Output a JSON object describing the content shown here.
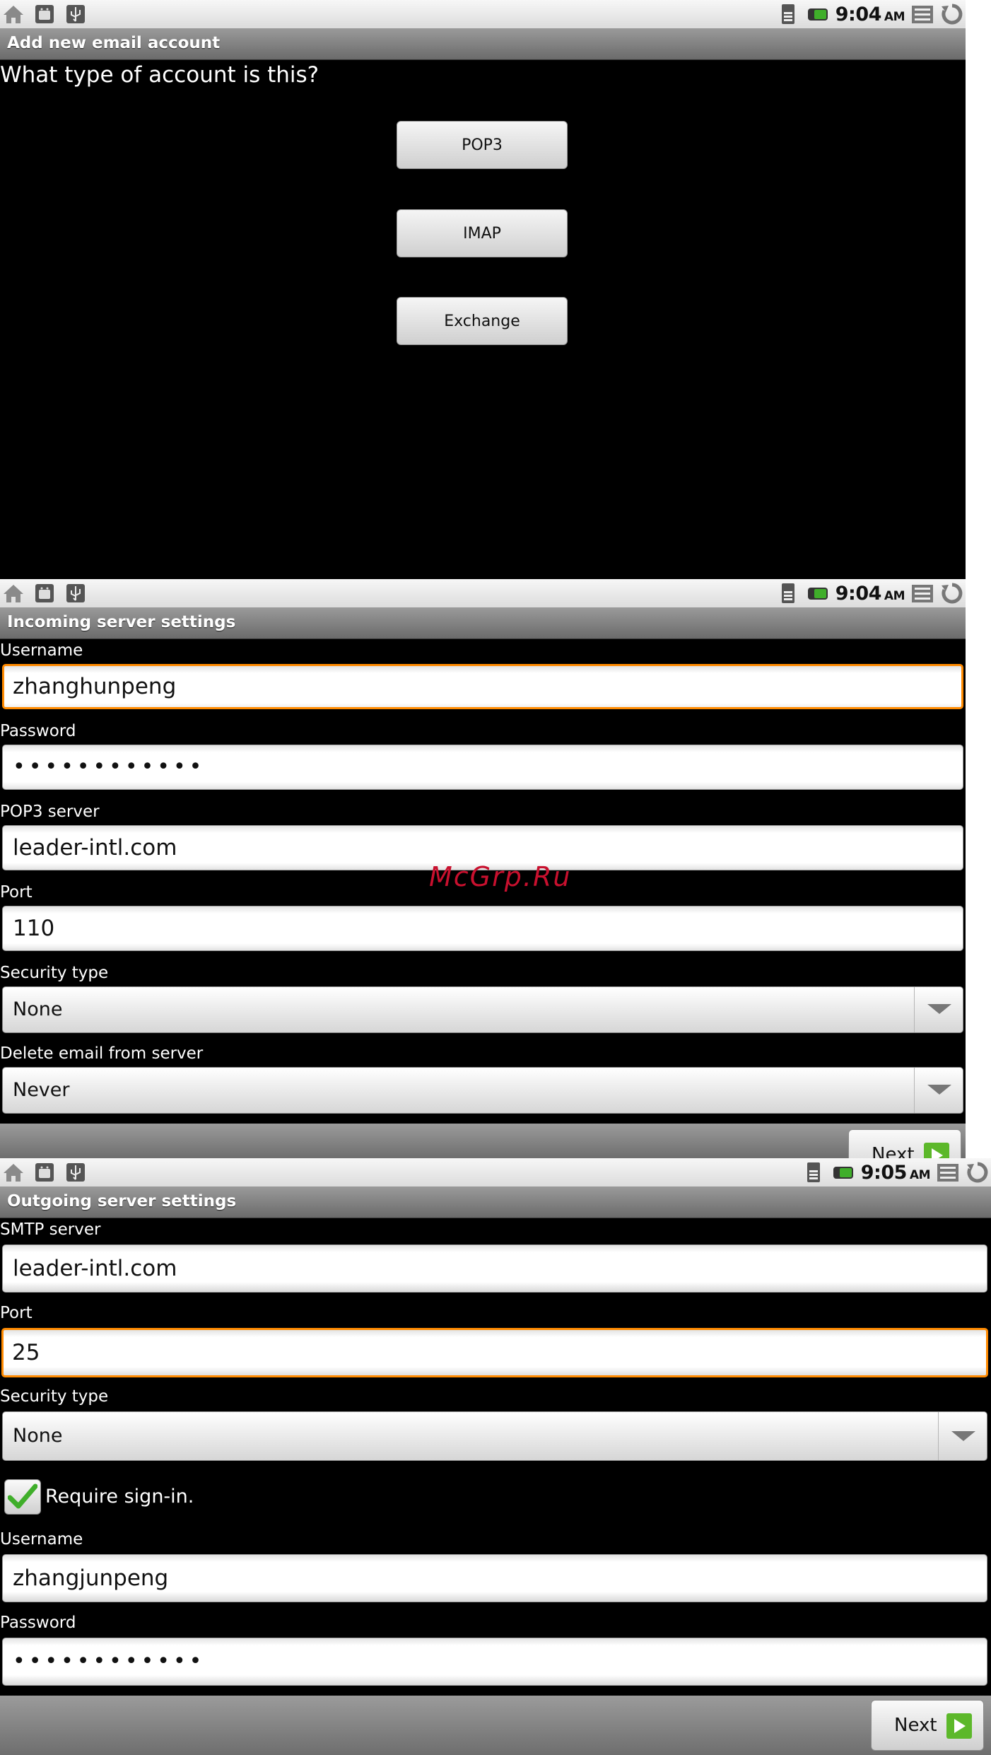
{
  "screen1": {
    "status": {
      "time": "9:04",
      "ampm": "AM"
    },
    "title": "Add new email account",
    "question": "What type of account is this?",
    "buttons": [
      "POP3",
      "IMAP",
      "Exchange"
    ]
  },
  "screen2": {
    "status": {
      "time": "9:04",
      "ampm": "AM"
    },
    "title": "Incoming server settings",
    "username_label": "Username",
    "username_value": "zhanghunpeng",
    "password_label": "Password",
    "password_value": "••••••••••••",
    "server_label": "POP3 server",
    "server_value": "leader-intl.com",
    "port_label": "Port",
    "port_value": "110",
    "security_label": "Security type",
    "security_value": "None",
    "delete_label": "Delete email from server",
    "delete_value": "Never",
    "next_label": "Next"
  },
  "screen3": {
    "status": {
      "time": "9:05",
      "ampm": "AM"
    },
    "title": "Outgoing server settings",
    "server_label": "SMTP server",
    "server_value": "leader-intl.com",
    "port_label": "Port",
    "port_value": "25",
    "security_label": "Security type",
    "security_value": "None",
    "require_signin_label": "Require sign-in.",
    "require_signin_checked": true,
    "username_label": "Username",
    "username_value": "zhangjunpeng",
    "password_label": "Password",
    "password_value": "••••••••••••",
    "next_label": "Next"
  },
  "watermark": "McGrp.Ru",
  "colors": {
    "focus_border": "#ff8a00",
    "title_bar": "#7d7d7d",
    "next_arrow": "#5cb82a",
    "check": "#3fae2a",
    "watermark": "#c8102e"
  },
  "icons": {
    "status_left": [
      "home-icon",
      "android-icon",
      "usb-icon"
    ],
    "status_right": [
      "sd-card-icon",
      "battery-icon",
      "menu-icon",
      "back-icon"
    ]
  }
}
